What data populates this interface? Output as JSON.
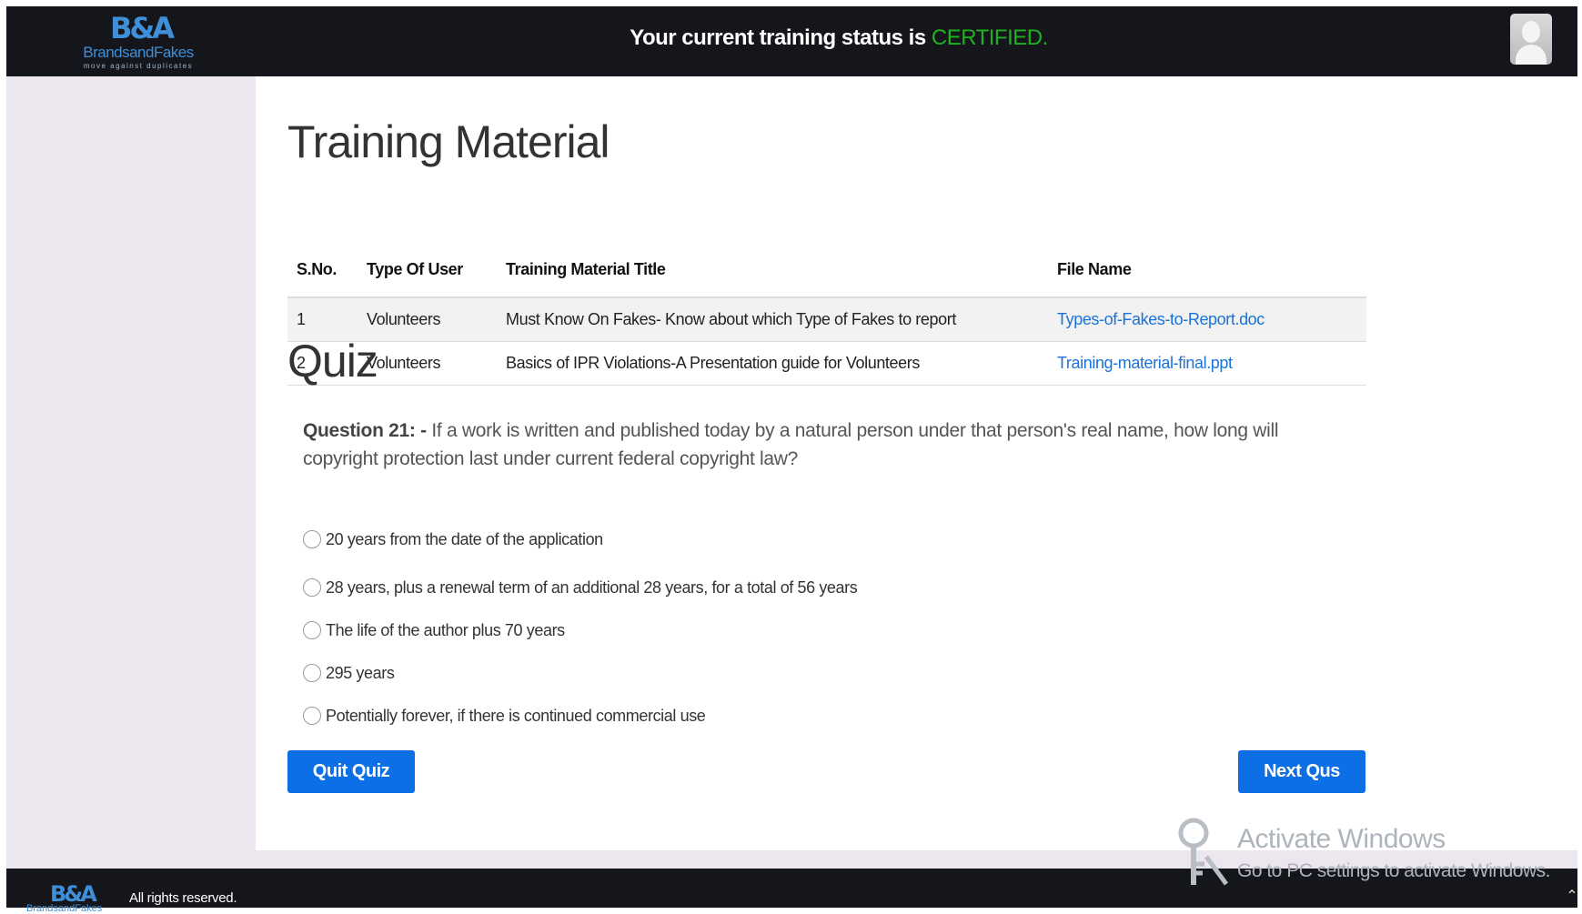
{
  "header": {
    "logo": {
      "mark": "B&A",
      "name": "BrandsandFakes",
      "tagline": "move against duplicates"
    },
    "status_prefix": "Your current training status is",
    "status_value": "CERTIFIED.",
    "status_color": "#1fb11f",
    "avatar_icon": "user-avatar-icon"
  },
  "training_material": {
    "title": "Training Material",
    "columns": [
      "S.No.",
      "Type Of User",
      "Training Material Title",
      "File Name"
    ],
    "rows": [
      {
        "sno": "1",
        "user_type": "Volunteers",
        "title": "Must Know On Fakes- Know about which Type of Fakes to report",
        "file": "Types-of-Fakes-to-Report.doc"
      },
      {
        "sno": "2",
        "user_type": "Volunteers",
        "title": "Basics of IPR Violations-A Presentation guide for Volunteers",
        "file": "Training-material-final.ppt"
      }
    ]
  },
  "quiz": {
    "title": "Quiz",
    "question_label": "Question 21: -",
    "question_text": "If a work is written and published today by a natural person under that person's real name, how long will copyright protection last under current federal copyright law?",
    "options": [
      "20 years from the date of the application",
      "28 years, plus a renewal term of an additional 28 years, for a total of 56 years",
      "The life of the author plus 70 years",
      "295 years",
      "Potentially forever, if there is continued commercial use"
    ],
    "quit_label": "Quit Quiz",
    "next_label": "Next Qus",
    "button_color": "#0d6fe6"
  },
  "footer": {
    "logo_mark": "B&A",
    "logo_name": "BrandsandFakes",
    "text": "All rights reserved.",
    "scroll_icon": "chevron-up-icon"
  },
  "watermark": {
    "title": "Activate Windows",
    "subtitle": "Go to PC settings to activate Windows."
  }
}
